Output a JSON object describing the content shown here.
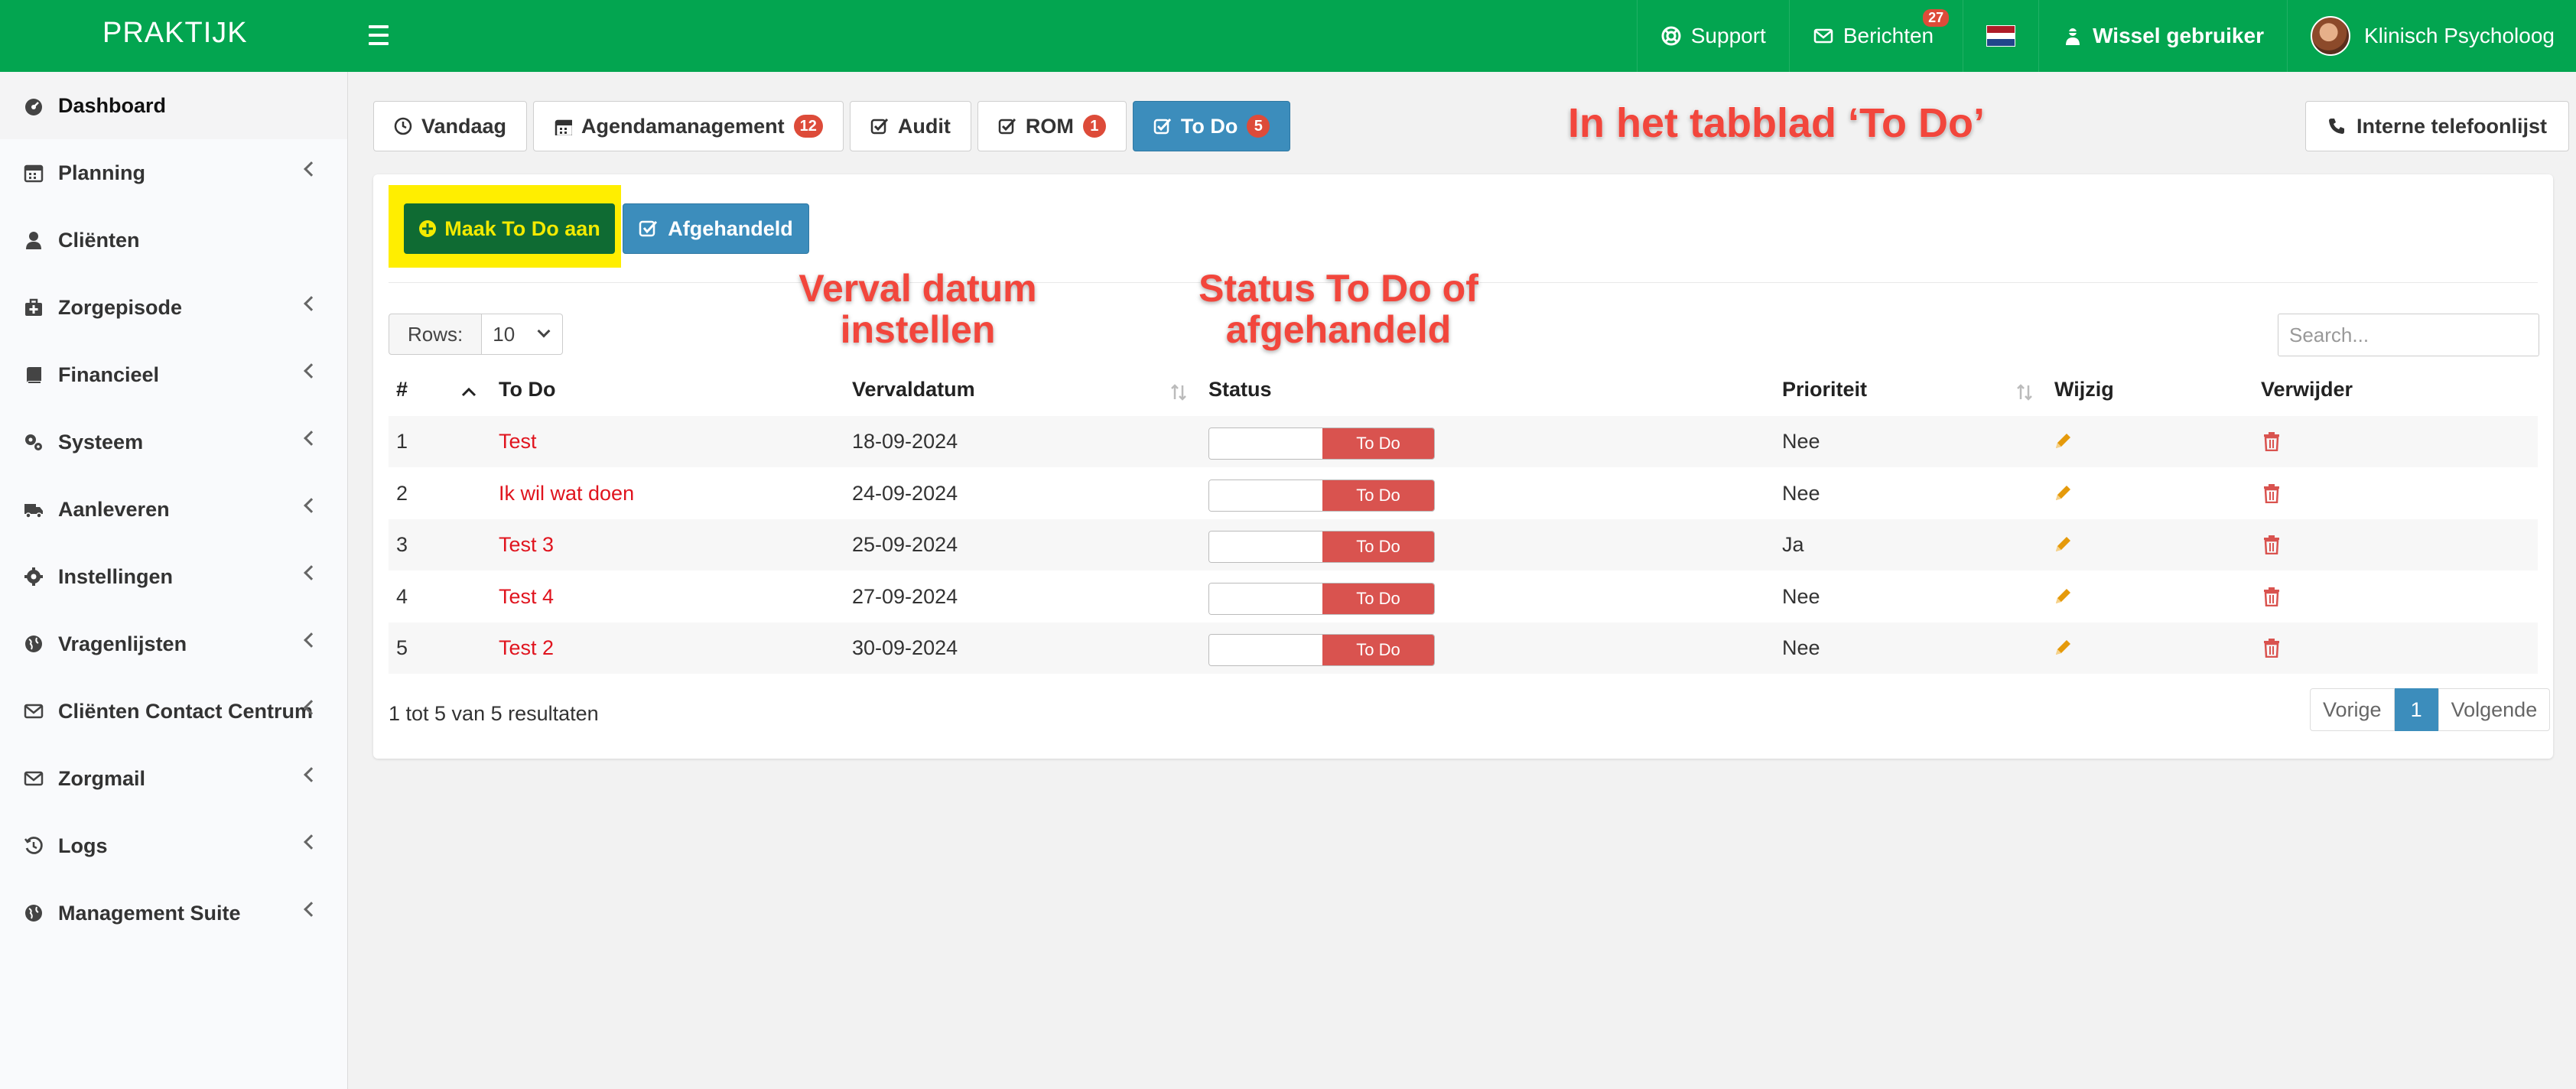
{
  "app": {
    "brand": "PRAKTIJK"
  },
  "topnav": {
    "support": "Support",
    "messages": "Berichten",
    "messages_count": "27",
    "switch_user": "Wissel gebruiker",
    "user": "Klinisch Psycholoog"
  },
  "sidebar": {
    "items": [
      {
        "label": "Dashboard",
        "icon": "dashboard-icon",
        "active": true,
        "submenu": false
      },
      {
        "label": "Planning",
        "icon": "calendar-icon",
        "submenu": true
      },
      {
        "label": "Cliënten",
        "icon": "user-icon",
        "submenu": false
      },
      {
        "label": "Zorgepisode",
        "icon": "medkit-icon",
        "submenu": true
      },
      {
        "label": "Financieel",
        "icon": "book-icon",
        "submenu": true
      },
      {
        "label": "Systeem",
        "icon": "cogs-icon",
        "submenu": true
      },
      {
        "label": "Aanleveren",
        "icon": "truck-icon",
        "submenu": true
      },
      {
        "label": "Instellingen",
        "icon": "gear-icon",
        "submenu": true
      },
      {
        "label": "Vragenlijsten",
        "icon": "globe-icon",
        "submenu": true
      },
      {
        "label": "Cliënten Contact Centrum",
        "icon": "envelope-icon",
        "submenu": true
      },
      {
        "label": "Zorgmail",
        "icon": "envelope-icon",
        "submenu": true
      },
      {
        "label": "Logs",
        "icon": "history-icon",
        "submenu": true
      },
      {
        "label": "Management Suite",
        "icon": "globe-icon",
        "submenu": true
      }
    ]
  },
  "tabs": [
    {
      "label": "Vandaag",
      "icon": "clock-icon",
      "count": null,
      "active": false
    },
    {
      "label": "Agendamanagement",
      "icon": "calendar-icon",
      "count": "12",
      "active": false
    },
    {
      "label": "Audit",
      "icon": "check-square-icon",
      "count": null,
      "active": false
    },
    {
      "label": "ROM",
      "icon": "check-square-icon",
      "count": "1",
      "active": false
    },
    {
      "label": "To Do",
      "icon": "check-square-icon",
      "count": "5",
      "active": true
    }
  ],
  "phone_button": "Interne telefoonlijst",
  "annotations": {
    "tab": "In het tabblad ‘To Do’",
    "date_line1": "Verval datum",
    "date_line2": "instellen",
    "status_line1": "Status To Do of",
    "status_line2": "afgehandeld"
  },
  "actions": {
    "create": "Maak To Do aan",
    "done": "Afgehandeld"
  },
  "table_controls": {
    "rows_label": "Rows:",
    "rows_value": "10",
    "search_placeholder": "Search..."
  },
  "table": {
    "headers": {
      "num": "#",
      "todo": "To Do",
      "due": "Vervaldatum",
      "status": "Status",
      "priority": "Prioriteit",
      "edit": "Wijzig",
      "delete": "Verwijder"
    },
    "rows": [
      {
        "num": "1",
        "todo": "Test",
        "due": "18-09-2024",
        "status": "To Do",
        "priority": "Nee"
      },
      {
        "num": "2",
        "todo": "Ik wil wat doen",
        "due": "24-09-2024",
        "status": "To Do",
        "priority": "Nee"
      },
      {
        "num": "3",
        "todo": "Test 3",
        "due": "25-09-2024",
        "status": "To Do",
        "priority": "Ja"
      },
      {
        "num": "4",
        "todo": "Test 4",
        "due": "27-09-2024",
        "status": "To Do",
        "priority": "Nee"
      },
      {
        "num": "5",
        "todo": "Test 2",
        "due": "30-09-2024",
        "status": "To Do",
        "priority": "Nee"
      }
    ]
  },
  "footer": {
    "info": "1 tot 5 van 5 resultaten"
  },
  "pagination": {
    "prev": "Vorige",
    "current": "1",
    "next": "Volgende"
  },
  "colors": {
    "header_green": "#03a550",
    "primary_blue": "#3c8dbc",
    "danger_red": "#d9534f",
    "link_red": "#e0141e",
    "highlight_yellow": "#ffee00",
    "annotation_red": "#f2463c"
  }
}
